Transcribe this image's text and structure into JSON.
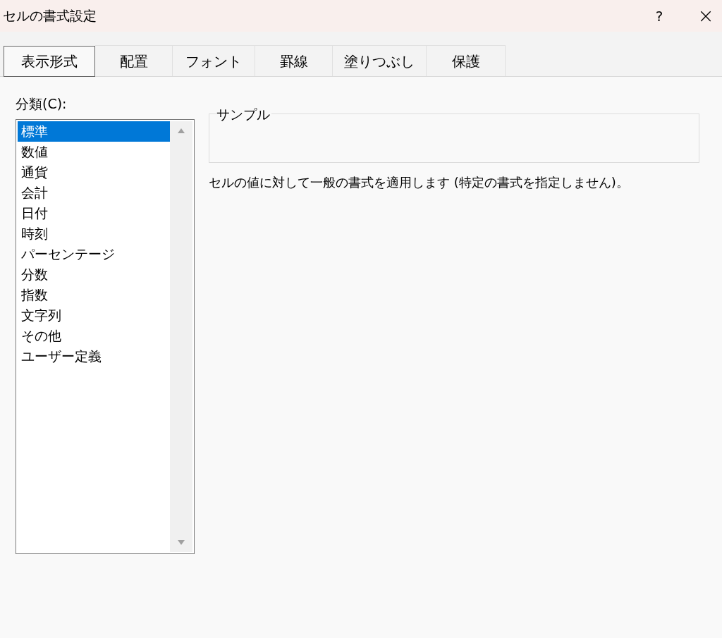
{
  "window": {
    "title": "セルの書式設定",
    "help": "?",
    "close": "×"
  },
  "tabs": [
    {
      "label": "表示形式",
      "selected": true
    },
    {
      "label": "配置",
      "selected": false
    },
    {
      "label": "フォント",
      "selected": false
    },
    {
      "label": "罫線",
      "selected": false
    },
    {
      "label": "塗りつぶし",
      "selected": false
    },
    {
      "label": "保護",
      "selected": false
    }
  ],
  "category": {
    "label": "分類(C):",
    "items": [
      {
        "label": "標準",
        "selected": true
      },
      {
        "label": "数値",
        "selected": false
      },
      {
        "label": "通貨",
        "selected": false
      },
      {
        "label": "会計",
        "selected": false
      },
      {
        "label": "日付",
        "selected": false
      },
      {
        "label": "時刻",
        "selected": false
      },
      {
        "label": "パーセンテージ",
        "selected": false
      },
      {
        "label": "分数",
        "selected": false
      },
      {
        "label": "指数",
        "selected": false
      },
      {
        "label": "文字列",
        "selected": false
      },
      {
        "label": "その他",
        "selected": false
      },
      {
        "label": "ユーザー定義",
        "selected": false
      }
    ]
  },
  "sample": {
    "label": "サンプル"
  },
  "description": "セルの値に対して一般の書式を適用します (特定の書式を指定しません)。"
}
